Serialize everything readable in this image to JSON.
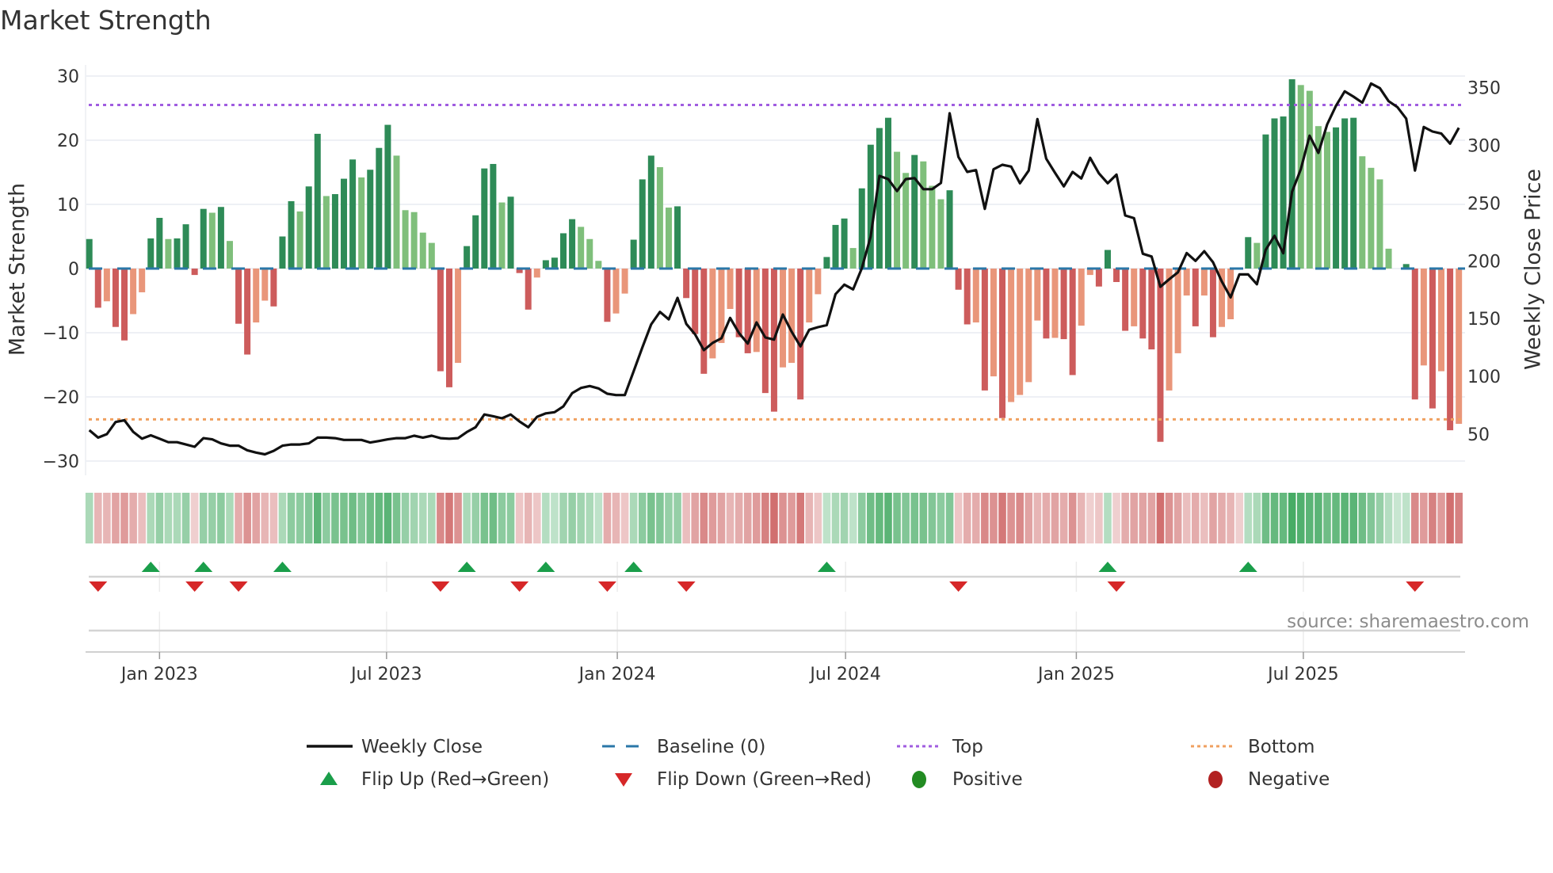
{
  "chart_data": {
    "type": "bar",
    "title": "Market Strength",
    "ylabel": "Market Strength",
    "y2label": "Weekly Close Price",
    "ylim": [
      -30,
      30
    ],
    "y2lim": [
      50,
      350
    ],
    "yticks": [
      "30",
      "20",
      "10",
      "0",
      "−10",
      "−20",
      "−30"
    ],
    "ytick_values": [
      30,
      20,
      10,
      0,
      -10,
      -20,
      -30
    ],
    "y2ticks": [
      "50",
      "100",
      "150",
      "200",
      "250",
      "300",
      "350"
    ],
    "y2tick_values": [
      50,
      100,
      150,
      200,
      250,
      300,
      350
    ],
    "xticks": [
      {
        "label": "Jan 2023",
        "date": "2023-01-01"
      },
      {
        "label": "Jul 2023",
        "date": "2023-07-01"
      },
      {
        "label": "Jan 2024",
        "date": "2024-01-01"
      },
      {
        "label": "Jul 2024",
        "date": "2024-07-01"
      },
      {
        "label": "Jan 2025",
        "date": "2025-01-01"
      },
      {
        "label": "Jul 2025",
        "date": "2025-07-01"
      }
    ],
    "start_date": "2022-11-06",
    "frequency": "weekly",
    "grid": true,
    "top_level": 25.5,
    "bottom_level": -23.5,
    "baseline": 0,
    "strength": [
      4.6,
      -6.1,
      -5.1,
      -9.1,
      -11.2,
      -7.1,
      -3.7,
      4.7,
      7.9,
      4.6,
      4.7,
      6.9,
      -1.0,
      9.3,
      8.7,
      9.6,
      4.3,
      -8.6,
      -13.4,
      -8.4,
      -5.0,
      -5.9,
      5.0,
      10.5,
      8.9,
      12.8,
      21.0,
      11.3,
      11.6,
      14.0,
      17.0,
      14.2,
      15.4,
      18.8,
      22.4,
      17.6,
      9.1,
      8.8,
      5.6,
      4.0,
      -16.0,
      -18.5,
      -14.7,
      3.5,
      8.3,
      15.6,
      16.3,
      10.3,
      11.2,
      -0.7,
      -6.4,
      -1.4,
      1.3,
      1.7,
      5.5,
      7.7,
      6.5,
      4.6,
      1.2,
      -8.3,
      -7.0,
      -3.9,
      4.5,
      13.9,
      17.6,
      15.8,
      9.5,
      9.7,
      -4.6,
      -10.2,
      -16.4,
      -14.0,
      -11.6,
      -6.3,
      -10.7,
      -13.2,
      -13.0,
      -19.4,
      -22.3,
      -15.4,
      -14.7,
      -20.4,
      -8.4,
      -4.0,
      1.8,
      6.8,
      7.8,
      3.2,
      12.5,
      19.3,
      21.9,
      23.5,
      18.2,
      14.9,
      17.7,
      16.7,
      12.9,
      10.8,
      12.2,
      -3.3,
      -8.7,
      -8.4,
      -19.0,
      -16.8,
      -23.3,
      -20.8,
      -19.7,
      -17.7,
      -8.1,
      -10.9,
      -10.8,
      -11.0,
      -16.6,
      -8.9,
      -1.0,
      -2.8,
      2.9,
      -2.1,
      -9.7,
      -9.0,
      -10.9,
      -12.6,
      -27.0,
      -19.0,
      -13.2,
      -4.2,
      -9.0,
      -4.2,
      -10.7,
      -9.1,
      -7.9,
      0,
      4.9,
      4.0,
      20.9,
      23.4,
      23.7,
      29.5,
      28.6,
      27.7,
      22.2,
      21.3,
      22.0,
      23.4,
      23.5,
      17.5,
      15.7,
      13.9,
      3.1,
      0,
      0.7,
      -20.4,
      -15.1,
      -21.8,
      -16.0,
      -25.2,
      -24.2
    ],
    "weekly_close": [
      53.4,
      47,
      50,
      60.5,
      62,
      52,
      46,
      49,
      46,
      43,
      43,
      41,
      39,
      46.5,
      45.5,
      42,
      40,
      40,
      36,
      34,
      32.5,
      35.5,
      40,
      41,
      41,
      42,
      47,
      47,
      46.5,
      45,
      45,
      45,
      42.7,
      44,
      45.5,
      46.5,
      46.5,
      48.6,
      47,
      48.6,
      46.5,
      46,
      46.5,
      51.8,
      56,
      67,
      65.5,
      63.7,
      67,
      61,
      56,
      65,
      68,
      69,
      74,
      85.5,
      90,
      91.6,
      89.6,
      85,
      83.8,
      83.8,
      104.4,
      125,
      145,
      155.8,
      149.4,
      168,
      145.5,
      136.4,
      122.7,
      129,
      133,
      150.6,
      137.6,
      128.4,
      146.7,
      133.7,
      131.8,
      153.6,
      138.7,
      126,
      140.3,
      142.6,
      144.4,
      171.2,
      179.4,
      175.3,
      193.6,
      221,
      273.6,
      270.8,
      260.4,
      270.8,
      271.7,
      262.1,
      262.1,
      267.4,
      327.8,
      290,
      277,
      278.6,
      245,
      279.3,
      283.2,
      281.6,
      267.2,
      278.2,
      322.8,
      288.5,
      276.3,
      264.5,
      277,
      271.3,
      289.2,
      275.8,
      267.2,
      274.7,
      239.3,
      237,
      206.2,
      203.8,
      177.6,
      184,
      190.1,
      206.8,
      200,
      208.4,
      198.8,
      182.2,
      168.4,
      188.3,
      188.3,
      179.8,
      209.6,
      221.7,
      206.6,
      259.9,
      279.3,
      308.4,
      293.5,
      318.2,
      334.2,
      346.8,
      342.2,
      337,
      353.6,
      349.5,
      338.3,
      333.1,
      323.2,
      278.2,
      315.9,
      312,
      310.2,
      301.5,
      315.2
    ],
    "strip_intensity": [
      0.3,
      -0.3,
      -0.3,
      -0.4,
      -0.45,
      -0.35,
      -0.25,
      0.3,
      0.4,
      0.3,
      0.3,
      0.4,
      -0.15,
      0.4,
      0.4,
      0.45,
      0.3,
      -0.35,
      -0.5,
      -0.4,
      -0.3,
      -0.25,
      0.3,
      0.45,
      0.45,
      0.5,
      0.7,
      0.45,
      0.55,
      0.55,
      0.6,
      0.5,
      0.6,
      0.65,
      0.7,
      0.55,
      0.4,
      0.35,
      0.3,
      0.3,
      -0.55,
      -0.65,
      -0.5,
      0.3,
      0.4,
      0.55,
      0.6,
      0.45,
      0.45,
      -0.2,
      -0.3,
      -0.2,
      0.25,
      0.2,
      0.35,
      0.4,
      0.35,
      0.3,
      0.2,
      -0.35,
      -0.3,
      -0.2,
      0.3,
      0.45,
      0.55,
      0.5,
      0.4,
      0.4,
      -0.25,
      -0.4,
      -0.55,
      -0.45,
      -0.4,
      -0.3,
      -0.35,
      -0.4,
      -0.45,
      -0.6,
      -0.7,
      -0.5,
      -0.45,
      -0.65,
      -0.3,
      -0.2,
      0.2,
      0.3,
      0.35,
      0.2,
      0.45,
      0.6,
      0.65,
      0.7,
      0.55,
      0.5,
      0.55,
      0.55,
      0.5,
      0.45,
      0.5,
      -0.2,
      -0.35,
      -0.35,
      -0.55,
      -0.5,
      -0.65,
      -0.5,
      -0.55,
      -0.4,
      -0.3,
      -0.35,
      -0.4,
      -0.35,
      -0.5,
      -0.3,
      -0.15,
      -0.2,
      0.25,
      -0.15,
      -0.35,
      -0.4,
      -0.4,
      -0.4,
      -0.7,
      -0.5,
      -0.4,
      -0.25,
      -0.35,
      -0.25,
      -0.4,
      -0.35,
      -0.3,
      -0.15,
      0.25,
      0.3,
      0.6,
      0.65,
      0.65,
      0.8,
      0.75,
      0.7,
      0.7,
      0.6,
      0.65,
      0.7,
      0.7,
      0.6,
      0.5,
      0.4,
      0.25,
      0.15,
      0.2,
      -0.55,
      -0.45,
      -0.6,
      -0.45,
      -0.7,
      -0.6
    ],
    "flip_up_weeks": [
      8,
      14,
      23,
      44,
      53,
      63,
      85,
      117,
      133
    ],
    "flip_down_weeks": [
      2,
      13,
      18,
      41,
      50,
      60,
      69,
      100,
      118,
      152
    ],
    "legend": {
      "placement": "bottom",
      "weekly_close": "Weekly Close",
      "baseline": "Baseline (0)",
      "top": "Top",
      "bottom": "Bottom",
      "flip_up": "Flip Up (Red→Green)",
      "flip_down": "Flip Down (Green→Red)",
      "positive": "Positive",
      "negative": "Negative"
    },
    "source": "source: sharemaestro.com",
    "colors": {
      "pos_strong": "#2e8b57",
      "pos_weak": "#7fbf7b",
      "neg_strong": "#cd5c5c",
      "neg_weak": "#e9967a",
      "baseline": "#2a77a8",
      "top": "#a05ce0",
      "bottom": "#f0a060",
      "price": "#111111",
      "flip_up": "#1a9e4a",
      "flip_down": "#d62728",
      "positive": "#228b22",
      "negative": "#b22222"
    }
  }
}
